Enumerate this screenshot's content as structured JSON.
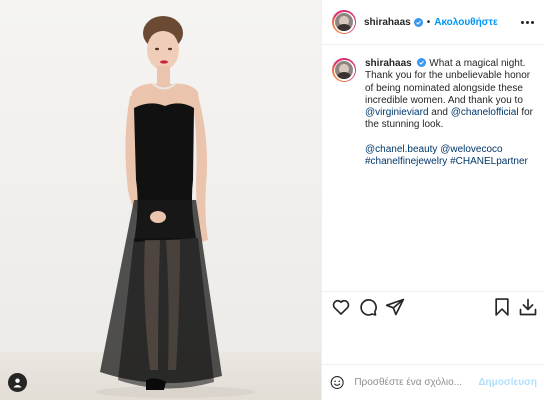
{
  "post": {
    "username": "shirahaas",
    "follow_label": "Ακολουθήστε",
    "separator": "•",
    "caption": {
      "author": "shirahaas",
      "text_1": "What a magical night. Thank you for the unbelievable honor of being nominated alongside these incredible women. And thank you to ",
      "mention_1": "@virginieviard",
      "text_2": " and ",
      "mention_2": "@chanelofficial",
      "text_3": " for the stunning look.",
      "tags": [
        "@chanel.beauty",
        "@welovecoco",
        "#chanelfinejewelry",
        "#CHANELpartner"
      ]
    },
    "comment": {
      "placeholder": "Προσθέστε ένα σχόλιο...",
      "post_label": "Δημοσίευση"
    }
  },
  "icons": {
    "tag": "person-tag-icon",
    "verified": "verified-badge-icon",
    "more": "more-options-icon",
    "like": "heart-icon",
    "comment": "comment-icon",
    "share": "share-icon",
    "save": "bookmark-icon",
    "download": "download-icon",
    "emoji": "emoji-icon"
  },
  "colors": {
    "accent": "#0095f6",
    "link": "#00376b",
    "post_disabled": "#b2dffc",
    "text": "#262626"
  }
}
